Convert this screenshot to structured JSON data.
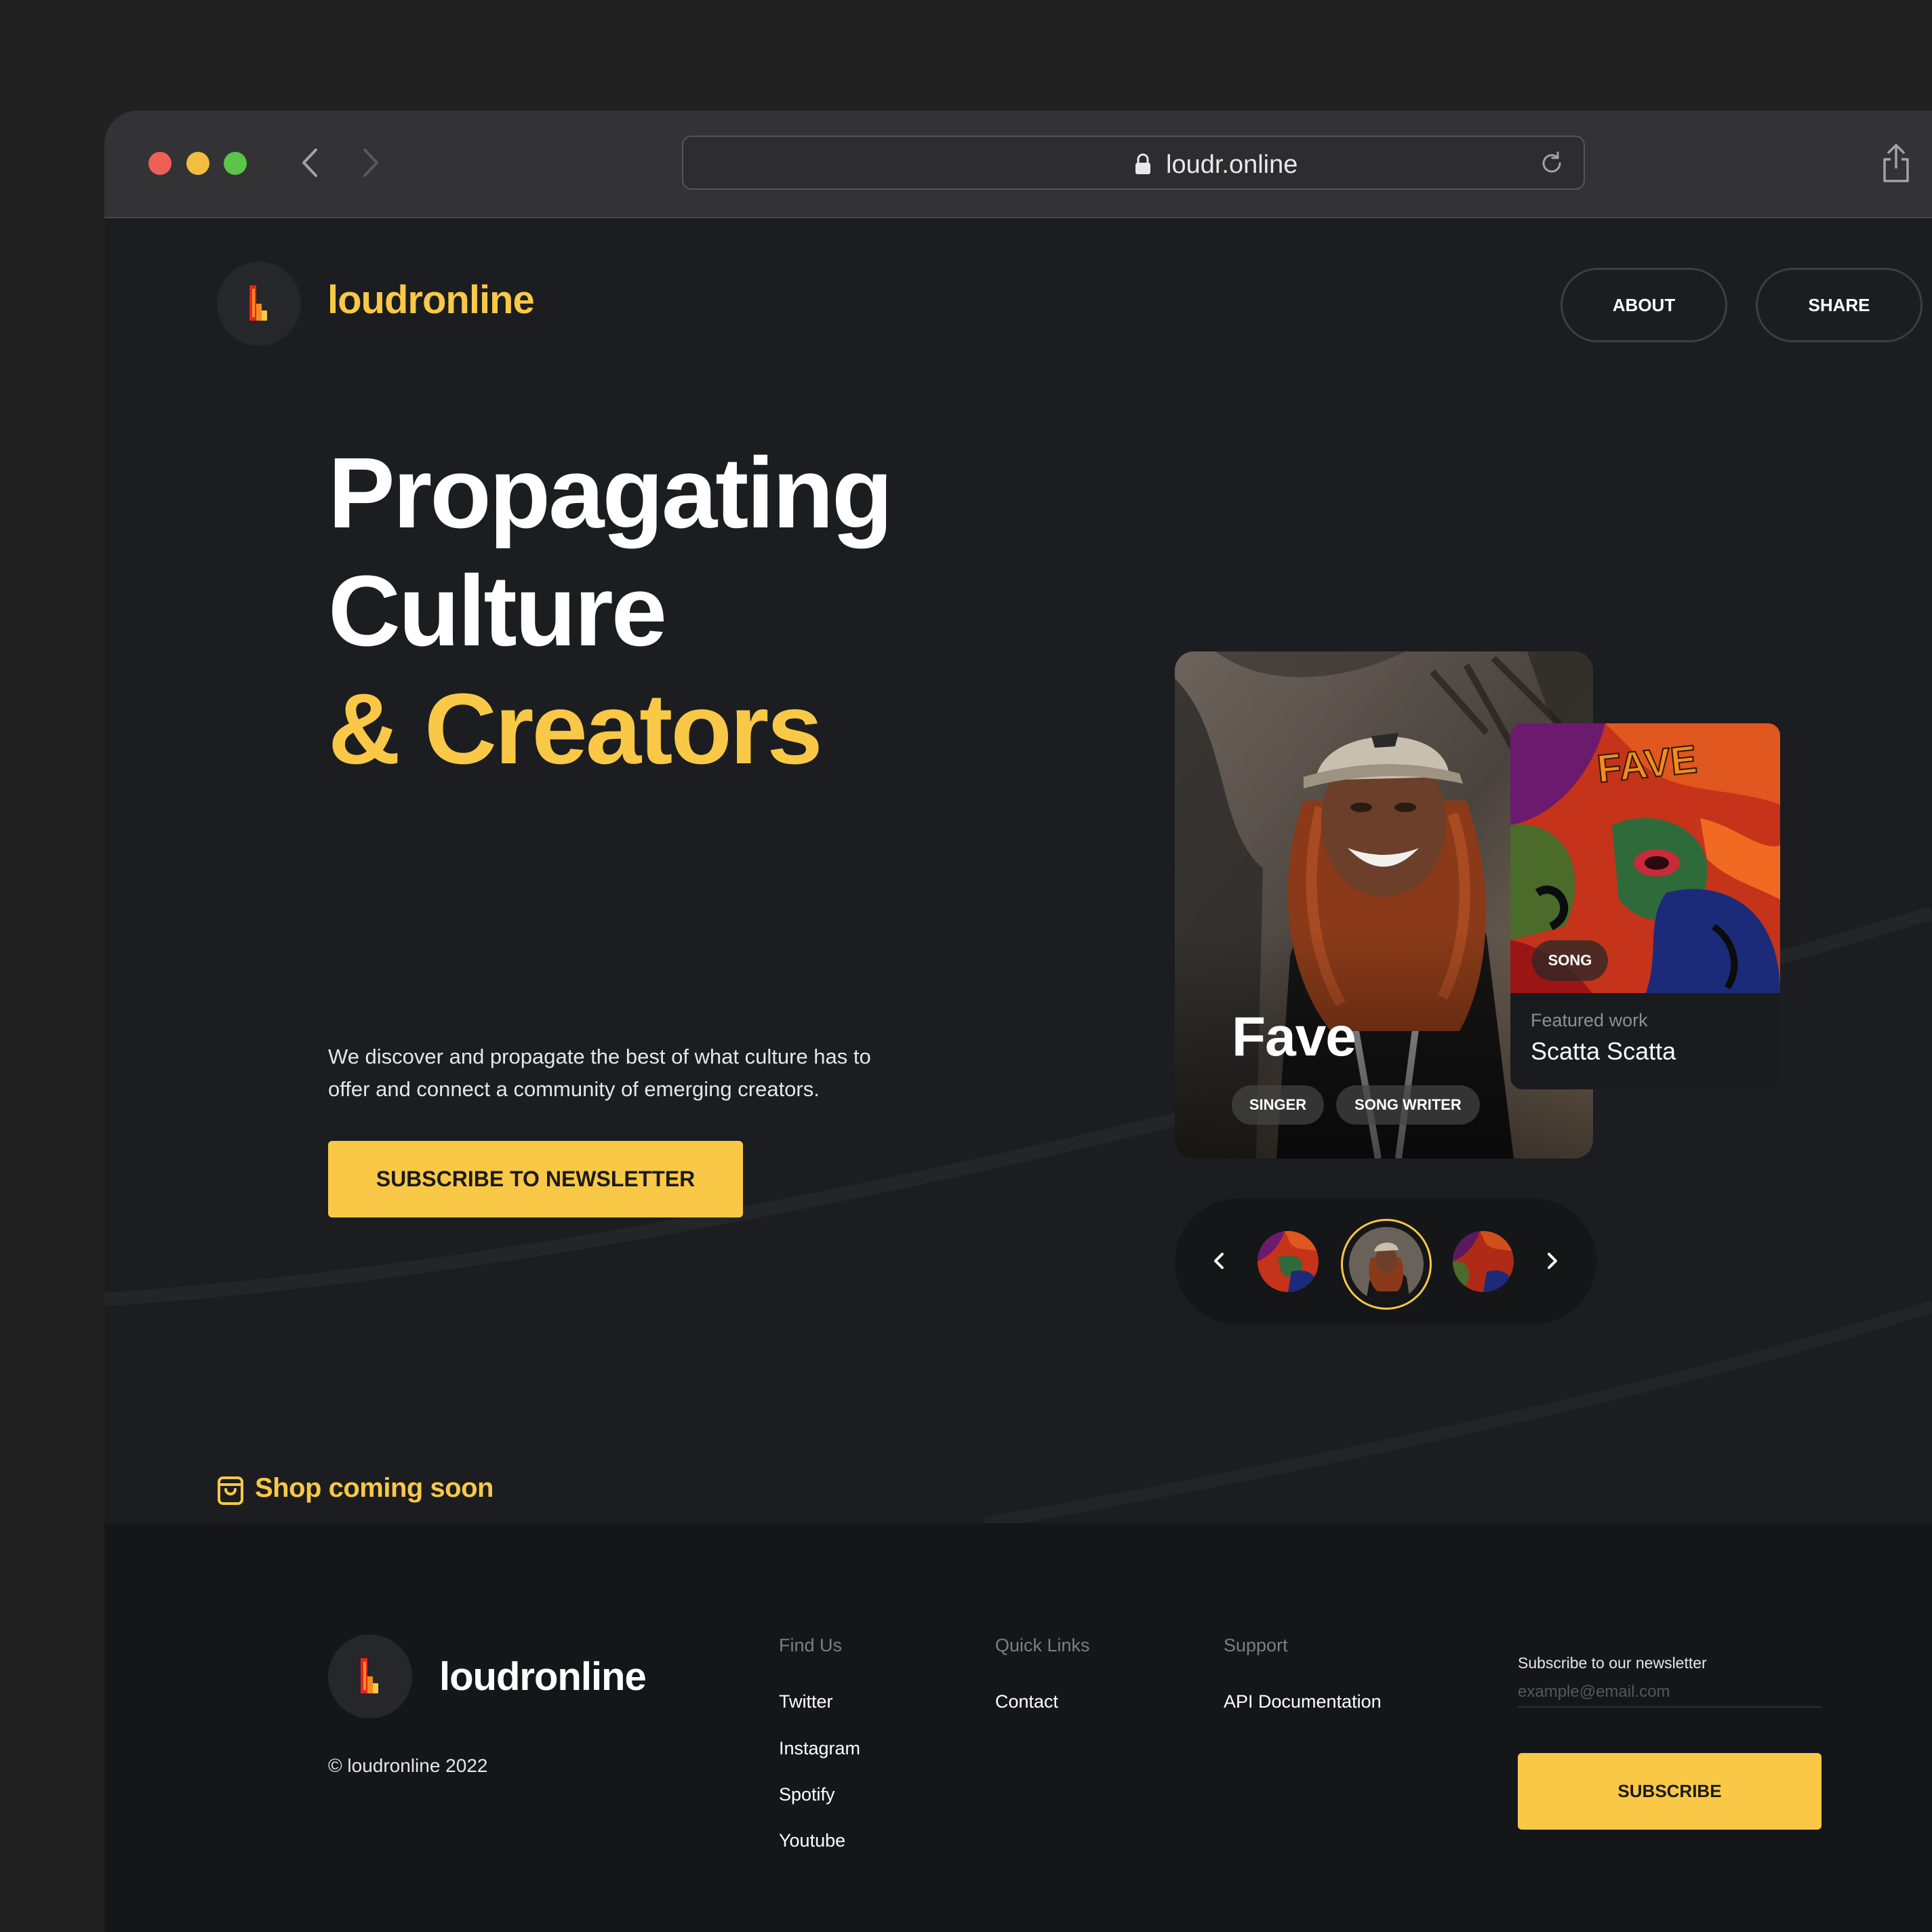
{
  "browser": {
    "url": "loudr.online"
  },
  "header": {
    "brand": "loudronline",
    "nav": [
      {
        "label": "ABOUT"
      },
      {
        "label": "SHARE"
      }
    ]
  },
  "hero": {
    "title_line1": "Propagating",
    "title_line2": "Culture",
    "title_line3": "& Creators",
    "description": "We discover and propagate the best of what culture has to offer and connect a community  of emerging creators.",
    "cta_label": "SUBSCRIBE TO NEWSLETTER"
  },
  "featured": {
    "artist_name": "Fave",
    "tags": [
      "SINGER",
      "SONG WRITER"
    ],
    "song_tag": "SONG",
    "song_caption": "Featured work",
    "song_title": "Scatta Scatta",
    "art_text": "FAVE"
  },
  "shop": {
    "label": "Shop coming soon"
  },
  "footer": {
    "brand": "loudronline",
    "copyright": "© loudronline 2022",
    "columns": [
      {
        "title": "Find Us",
        "links": [
          "Twitter",
          "Instagram",
          "Spotify",
          "Youtube"
        ]
      },
      {
        "title": "Quick Links",
        "links": [
          "Contact"
        ]
      },
      {
        "title": "Support",
        "links": [
          "API Documentation"
        ]
      }
    ],
    "newsletter_label": "Subscribe to our newsletter",
    "email_placeholder": "example@email.com",
    "subscribe_label": "SUBSCRIBE"
  },
  "colors": {
    "accent": "#f9c846",
    "background": "#1b1d20",
    "footer_bg": "#141719"
  }
}
